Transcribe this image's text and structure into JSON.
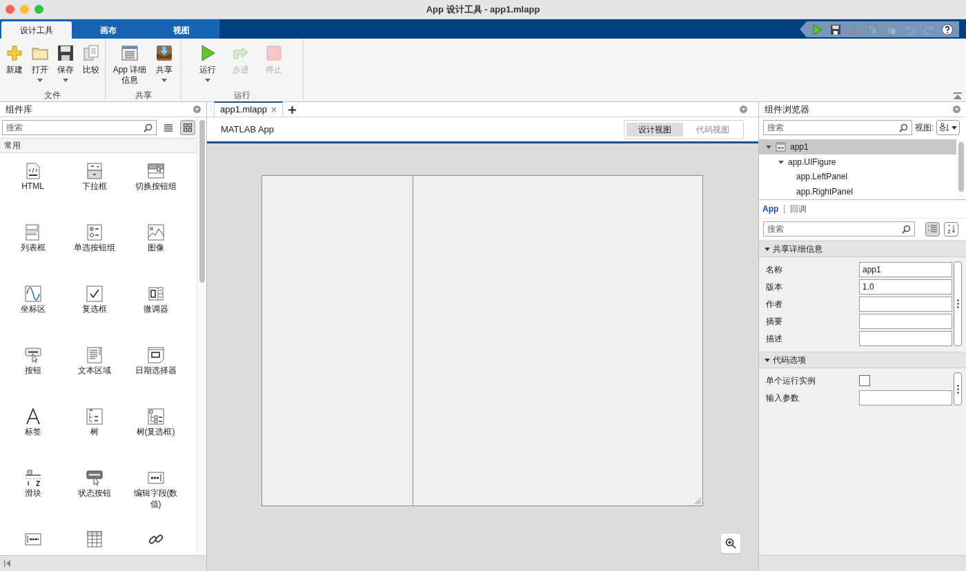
{
  "window": {
    "title": "App 设计工具 - app1.mlapp"
  },
  "ribbon_tabs": [
    {
      "label": "设计工具",
      "selected": true
    },
    {
      "label": "画布",
      "selected": false
    },
    {
      "label": "视图",
      "selected": false
    }
  ],
  "quick_access": [
    {
      "kind": "run",
      "disabled": false
    },
    {
      "kind": "save",
      "disabled": false
    },
    {
      "kind": "cut",
      "disabled": true
    },
    {
      "kind": "copy",
      "disabled": true
    },
    {
      "kind": "paste",
      "disabled": true
    },
    {
      "kind": "undo",
      "disabled": true
    },
    {
      "kind": "redo",
      "disabled": true
    },
    {
      "kind": "help",
      "disabled": false
    }
  ],
  "ribbon_groups": [
    {
      "label": "文件",
      "buttons": [
        {
          "kind": "new",
          "label": "新建",
          "dropdown": false,
          "disabled": false
        },
        {
          "kind": "open",
          "label": "打开",
          "dropdown": true,
          "disabled": false
        },
        {
          "kind": "save",
          "label": "保存",
          "dropdown": true,
          "disabled": false
        },
        {
          "kind": "compare",
          "label": "比较",
          "dropdown": false,
          "disabled": false
        }
      ]
    },
    {
      "label": "共享",
      "buttons": [
        {
          "kind": "details",
          "label": "App 详细信息",
          "dropdown": false,
          "disabled": false
        },
        {
          "kind": "share",
          "label": "共享",
          "dropdown": true,
          "disabled": false
        }
      ]
    },
    {
      "label": "运行",
      "buttons": [
        {
          "kind": "run",
          "label": "运行",
          "dropdown": true,
          "disabled": false
        },
        {
          "kind": "step",
          "label": "步进",
          "dropdown": false,
          "disabled": true
        },
        {
          "kind": "stop",
          "label": "停止",
          "dropdown": false,
          "disabled": true
        }
      ]
    }
  ],
  "component_library": {
    "title": "组件库",
    "search": {
      "placeholder": "搜索"
    },
    "view_modes": [
      {
        "kind": "list",
        "selected": false
      },
      {
        "kind": "grid",
        "selected": true
      }
    ],
    "section": "常用",
    "items": [
      {
        "label": "HTML"
      },
      {
        "label": "下拉框"
      },
      {
        "label": "切换按钮组"
      },
      {
        "label": "列表框"
      },
      {
        "label": "单选按钮组"
      },
      {
        "label": "图像"
      },
      {
        "label": "坐标区"
      },
      {
        "label": "复选框"
      },
      {
        "label": "微调器"
      },
      {
        "label": "按钮"
      },
      {
        "label": "文本区域"
      },
      {
        "label": "日期选择器"
      },
      {
        "label": "标签"
      },
      {
        "label": "树"
      },
      {
        "label": "树(复选框)"
      },
      {
        "label": "滑块"
      },
      {
        "label": "状态按钮"
      },
      {
        "label": "编辑字段(数值)"
      },
      {
        "kind": "clipped"
      },
      {
        "kind": "clipped"
      },
      {
        "kind": "clipped"
      }
    ]
  },
  "document_tabs": [
    {
      "label": "app1.mlapp",
      "selected": true
    }
  ],
  "designer": {
    "app_name": "MATLAB App",
    "views": [
      {
        "label": "设计视图",
        "selected": true
      },
      {
        "label": "代码视图",
        "selected": false
      }
    ]
  },
  "component_browser": {
    "title": "组件浏览器",
    "search": {
      "placeholder": "搜索"
    },
    "view_label": "视图:",
    "tree": [
      {
        "label": "app1",
        "selected": true,
        "expanded": true,
        "children": [
          {
            "label": "app.UIFigure",
            "selected": false,
            "expanded": true,
            "children": [
              {
                "label": "app.LeftPanel",
                "selected": false
              },
              {
                "label": "app.RightPanel",
                "selected": false
              }
            ]
          }
        ]
      }
    ]
  },
  "inspector": {
    "tabs": [
      {
        "label": "App",
        "selected": true
      },
      {
        "label": "回调",
        "selected": false
      }
    ],
    "search": {
      "placeholder": "搜索"
    },
    "sort_modes": [
      {
        "kind": "grouped",
        "selected": true
      },
      {
        "kind": "alphabetical",
        "selected": false
      }
    ],
    "sections": [
      {
        "title": "共享详细信息",
        "expanded": true,
        "properties": [
          {
            "label": "名称",
            "kind": "text",
            "value": "app1"
          },
          {
            "label": "版本",
            "kind": "text",
            "value": "1.0"
          },
          {
            "label": "作者",
            "kind": "text"
          },
          {
            "label": "摘要",
            "kind": "text"
          },
          {
            "label": "描述",
            "kind": "text"
          }
        ]
      },
      {
        "title": "代码选项",
        "expanded": true,
        "properties": [
          {
            "label": "单个运行实例",
            "kind": "checkbox",
            "checked": false
          },
          {
            "label": "输入参数",
            "kind": "text"
          }
        ]
      }
    ]
  }
}
